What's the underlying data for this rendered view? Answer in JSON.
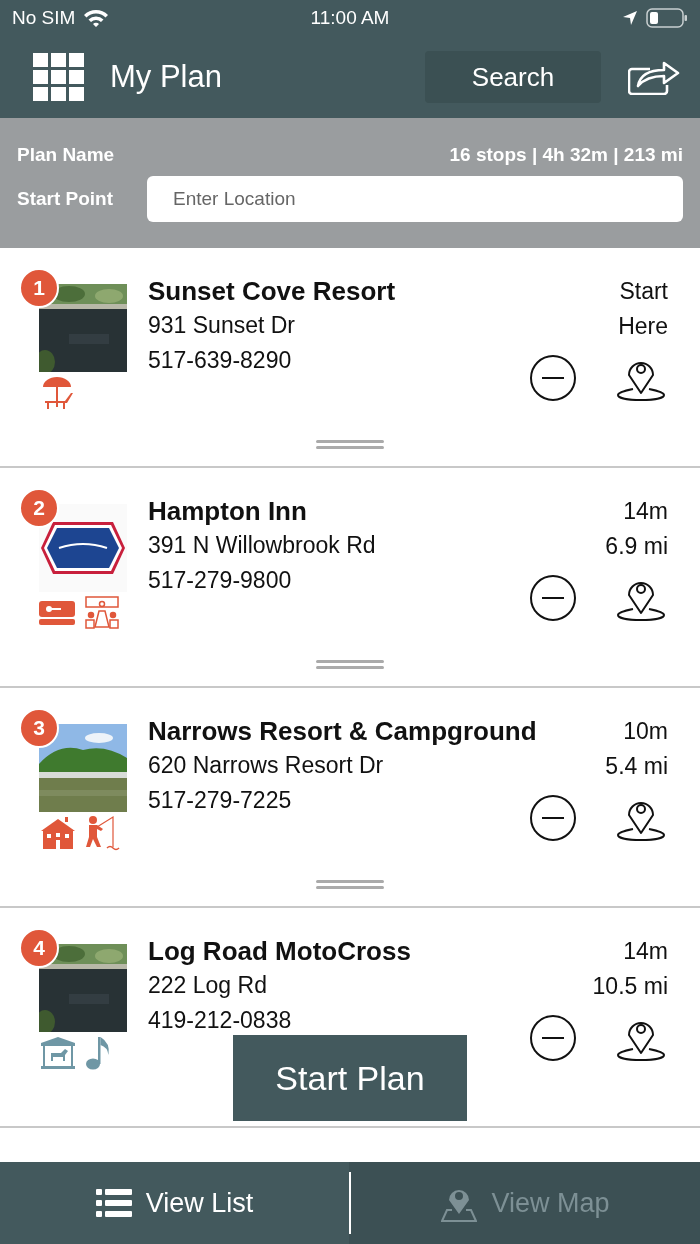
{
  "status_bar": {
    "carrier": "No SIM",
    "time": "11:00 AM"
  },
  "header": {
    "title": "My Plan",
    "search_button": "Search"
  },
  "plan": {
    "name_label": "Plan Name",
    "summary": "16 stops | 4h 32m | 213 mi",
    "start_label": "Start Point",
    "start_placeholder": "Enter Location"
  },
  "stops": [
    {
      "number": "1",
      "name": "Sunset Cove Resort",
      "address": "931 Sunset Dr",
      "phone": "517-639-8290",
      "travel": [
        "Start",
        "Here"
      ],
      "image": {
        "kind": "picture"
      },
      "amenities": [
        {
          "kind": "beach",
          "color": "#e0573a"
        }
      ]
    },
    {
      "number": "2",
      "name": "Hampton Inn",
      "address": "391 N Willowbrook Rd",
      "phone": "517-279-9800",
      "travel": [
        "14m",
        "6.9 mi"
      ],
      "image": {
        "kind": "logo"
      },
      "amenities": [
        {
          "kind": "keycard",
          "color": "#e0573a"
        },
        {
          "kind": "meeting",
          "color": "#e0573a"
        }
      ]
    },
    {
      "number": "3",
      "name": "Narrows Resort & Campground",
      "address": "620 Narrows Resort Dr",
      "phone": "517-279-7225",
      "travel": [
        "10m",
        "5.4 mi"
      ],
      "image": {
        "kind": "picture"
      },
      "amenities": [
        {
          "kind": "lodge",
          "color": "#e0573a"
        },
        {
          "kind": "fishing",
          "color": "#e0573a"
        }
      ]
    },
    {
      "number": "4",
      "name": "Log Road MotoCross",
      "address": "222 Log Rd",
      "phone": "419-212-0838",
      "travel": [
        "14m",
        "10.5 mi"
      ],
      "image": {
        "kind": "picture"
      },
      "amenities": [
        {
          "kind": "carousel",
          "color": "#6f97a5"
        },
        {
          "kind": "music",
          "color": "#6f97a5"
        }
      ]
    }
  ],
  "start_button": "Start Plan",
  "tabs": [
    {
      "label": "View List",
      "selected": true
    },
    {
      "label": "View Map",
      "selected": false
    }
  ]
}
